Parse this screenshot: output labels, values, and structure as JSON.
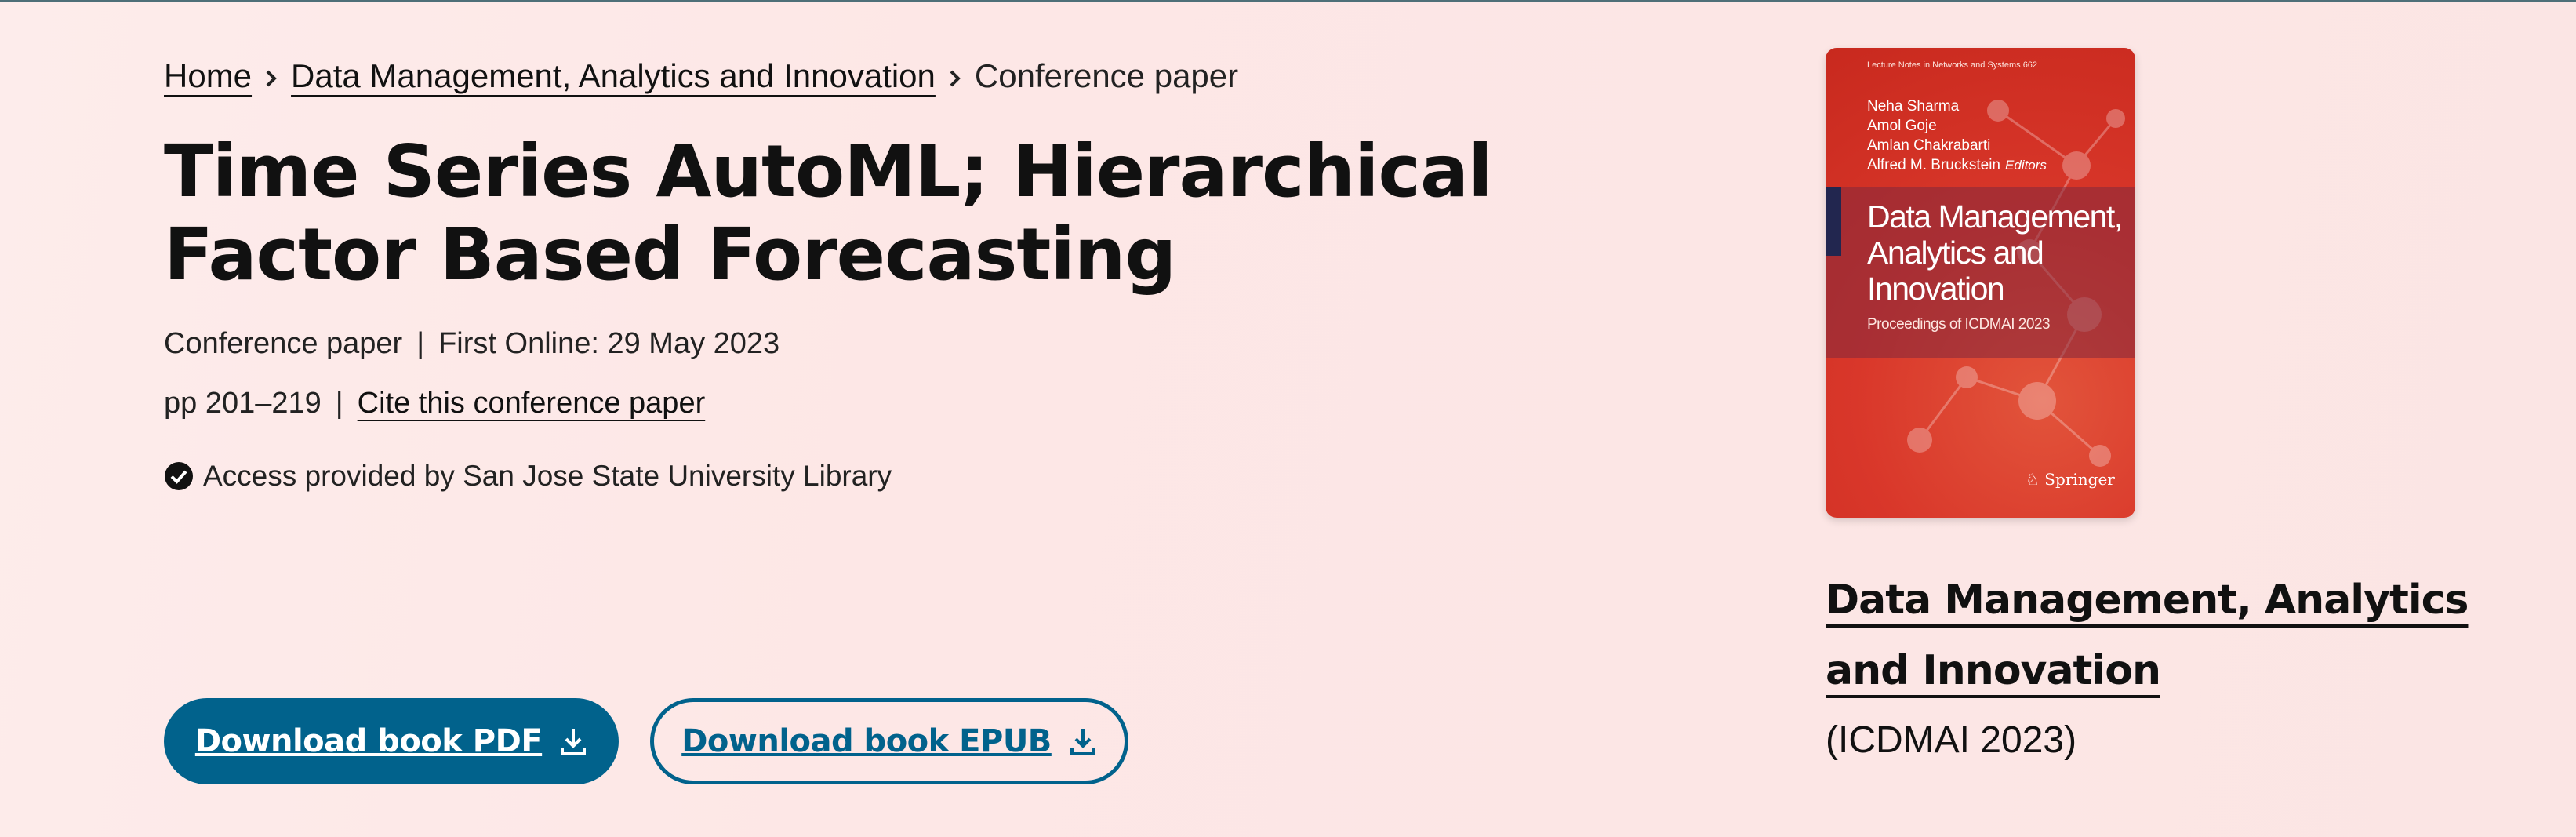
{
  "breadcrumb": {
    "home": "Home",
    "book": "Data Management, Analytics and Innovation",
    "current": "Conference paper"
  },
  "title": "Time Series AutoML; Hierarchical Factor Based Forecasting",
  "meta": {
    "type": "Conference paper",
    "first_online": "First Online: 29 May 2023",
    "pages": "pp 201–219",
    "cite_link": "Cite this conference paper",
    "separator": "|"
  },
  "access": "Access provided by San Jose State University Library",
  "buttons": {
    "pdf": "Download book PDF",
    "epub": "Download book EPUB"
  },
  "cover": {
    "series": "Lecture Notes in Networks and Systems 662",
    "editors": [
      "Neha Sharma",
      "Amol Goje",
      "Amlan Chakrabarti",
      "Alfred M. Bruckstein"
    ],
    "editors_label": "Editors",
    "title": "Data Management, Analytics and Innovation",
    "subtitle": "Proceedings of ICDMAI 2023",
    "publisher": "Springer"
  },
  "sidebar": {
    "book_title": "Data Management, Analytics and Innovation",
    "conference": "(ICDMAI 2023)"
  },
  "colors": {
    "accent": "#01628c",
    "cover_red": "#d9372a"
  }
}
